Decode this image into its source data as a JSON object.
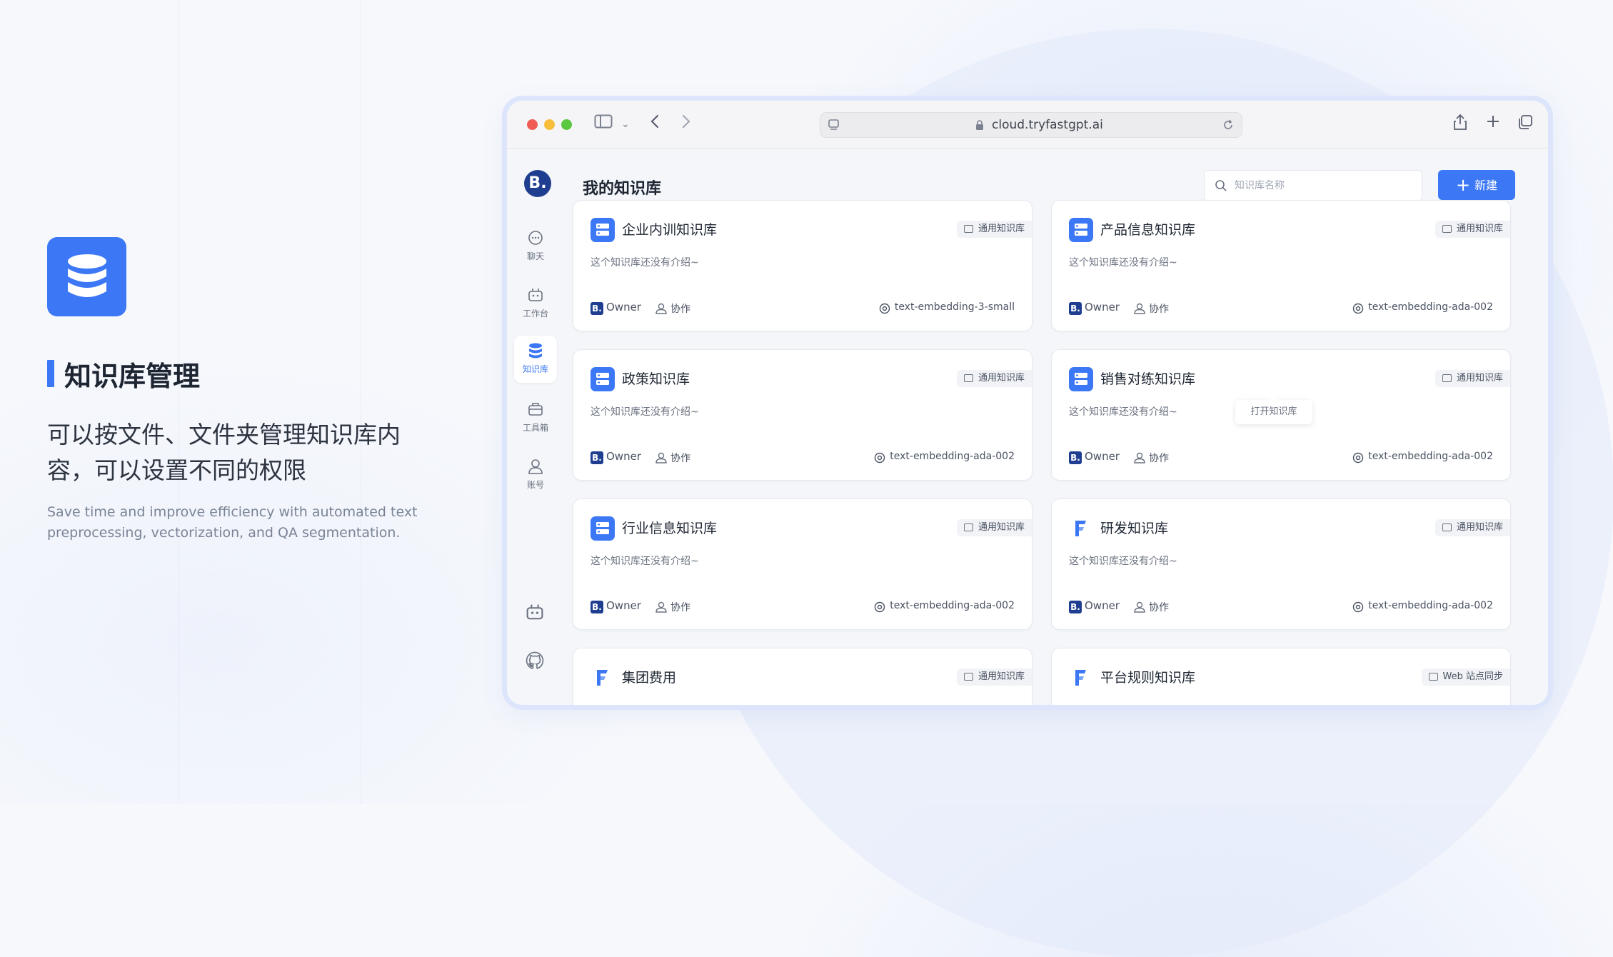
{
  "hero": {
    "icon": "database-icon",
    "title": "知识库管理",
    "desc": "可以按文件、文件夹管理知识库内容，可以设置不同的权限",
    "sub": "Save time and improve efficiency with automated text preprocessing, vectorization, and QA segmentation."
  },
  "browser": {
    "url": "cloud.tryfastgpt.ai"
  },
  "app": {
    "logo": "B.",
    "nav": [
      {
        "label": "聊天",
        "icon": "chat-icon"
      },
      {
        "label": "工作台",
        "icon": "robot-icon"
      },
      {
        "label": "知识库",
        "icon": "database-icon"
      },
      {
        "label": "工具箱",
        "icon": "toolbox-icon"
      },
      {
        "label": "账号",
        "icon": "user-icon"
      }
    ],
    "title": "我的知识库",
    "search_placeholder": "知识库名称",
    "new_label": "新建",
    "tooltip": "打开知识库",
    "cards": [
      {
        "name": "企业内训知识库",
        "tag": "通用知识库",
        "desc": "这个知识库还没有介绍~",
        "owner": "Owner",
        "collab": "协作",
        "model": "text-embedding-3-small"
      },
      {
        "name": "产品信息知识库",
        "tag": "通用知识库",
        "desc": "这个知识库还没有介绍~",
        "owner": "Owner",
        "collab": "协作",
        "model": "text-embedding-ada-002"
      },
      {
        "name": "政策知识库",
        "tag": "通用知识库",
        "desc": "这个知识库还没有介绍~",
        "owner": "Owner",
        "collab": "协作",
        "model": "text-embedding-ada-002"
      },
      {
        "name": "销售对练知识库",
        "tag": "通用知识库",
        "desc": "这个知识库还没有介绍~",
        "owner": "Owner",
        "collab": "协作",
        "model": "text-embedding-ada-002"
      },
      {
        "name": "行业信息知识库",
        "tag": "通用知识库",
        "desc": "这个知识库还没有介绍~",
        "owner": "Owner",
        "collab": "协作",
        "model": "text-embedding-ada-002"
      },
      {
        "name": "研发知识库",
        "tag": "通用知识库",
        "desc": "这个知识库还没有介绍~",
        "owner": "Owner",
        "collab": "协作",
        "model": "text-embedding-ada-002"
      },
      {
        "name": "集团费用",
        "tag": "通用知识库",
        "desc": "",
        "owner": "",
        "collab": "",
        "model": ""
      },
      {
        "name": "平台规则知识库",
        "tag": "Web 站点同步",
        "desc": "",
        "owner": "",
        "collab": "",
        "model": ""
      }
    ]
  },
  "colors": {
    "accent": "#3c78f6",
    "brand_dark": "#1f3e8f"
  }
}
